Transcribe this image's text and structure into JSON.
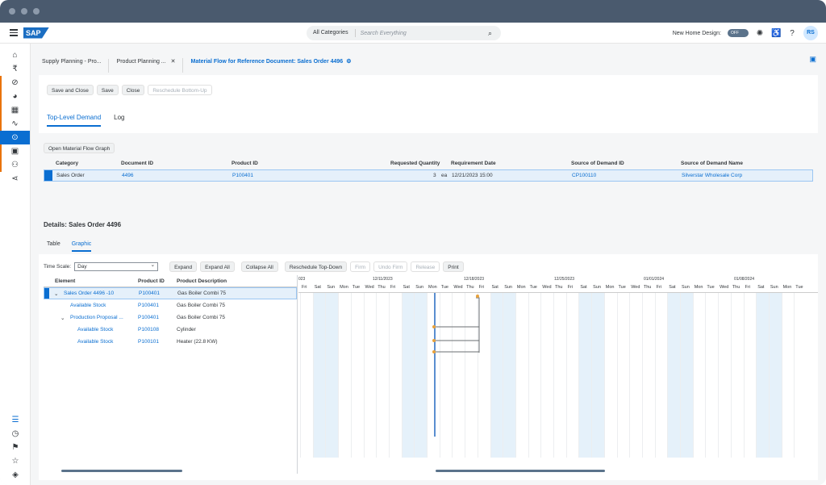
{
  "shell": {
    "brand": "SAP",
    "category": "All Categories",
    "search_placeholder": "Search Everything",
    "new_home_label": "New Home Design:",
    "toggle_label": "OFF",
    "avatar": "RS"
  },
  "tabs": [
    {
      "label": "Supply Planning - Pro..."
    },
    {
      "label": "Product Planning ..."
    },
    {
      "label": "Material Flow for Reference Document: Sales Order 4496"
    }
  ],
  "toolbar": {
    "save_close": "Save and Close",
    "save": "Save",
    "close": "Close",
    "reschedule_bu": "Reschedule Bottom-Up"
  },
  "subtabs": {
    "top_level": "Top-Level Demand",
    "log": "Log"
  },
  "omf_button": "Open Material Flow Graph",
  "demand_table": {
    "headers": {
      "category": "Category",
      "doc_id": "Document ID",
      "product_id": "Product ID",
      "req_qty": "Requested Quantity",
      "req_date": "Requirement Date",
      "src_id": "Source of Demand ID",
      "src_name": "Source of Demand Name"
    },
    "row": {
      "category": "Sales Order",
      "doc_id": "4496",
      "product_id": "P100401",
      "qty": "3",
      "unit": "ea",
      "date": "12/21/2023 15:00",
      "src_id": "CP100110",
      "src_name": "Silverstar Wholesale Corp"
    }
  },
  "details_title": "Details: Sales Order 4496",
  "graph_tabs": {
    "table": "Table",
    "graphic": "Graphic"
  },
  "graph_tools": {
    "time_scale_label": "Time Scale:",
    "time_scale_value": "Day",
    "expand": "Expand",
    "expand_all": "Expand All",
    "collapse_all": "Collapse All",
    "reschedule_td": "Reschedule Top-Down",
    "firm": "Firm",
    "undo_firm": "Undo Firm",
    "release": "Release",
    "print": "Print"
  },
  "tree": {
    "headers": {
      "element": "Element",
      "product_id": "Product ID",
      "description": "Product Description"
    },
    "rows": [
      {
        "element": "Sales Order 4496 -10",
        "product_id": "P100401",
        "description": "Gas Boiler Combi 75"
      },
      {
        "element": "Available Stock",
        "product_id": "P100401",
        "description": "Gas Boiler Combi 75"
      },
      {
        "element": "Production Proposal ...",
        "product_id": "P100401",
        "description": "Gas Boiler Combi 75"
      },
      {
        "element": "Available Stock",
        "product_id": "P100108",
        "description": "Cylinder"
      },
      {
        "element": "Available Stock",
        "product_id": "P100101",
        "description": "Heater (22.8 KW)"
      }
    ]
  },
  "gantt": {
    "weeks": [
      "023",
      "12/11/2023",
      "12/18/2023",
      "12/25/2023",
      "01/01/2024",
      "01/08/2024"
    ],
    "days": [
      "Fri",
      "Sat",
      "Sun",
      "Mon",
      "Tue",
      "Wed",
      "Thu",
      "Fri",
      "Sat",
      "Sun",
      "Mon",
      "Tue",
      "Wed",
      "Thu",
      "Fri",
      "Sat",
      "Sun",
      "Mon",
      "Tue",
      "Wed",
      "Thu",
      "Fri",
      "Sat",
      "Sun",
      "Mon",
      "Tue",
      "Wed",
      "Thu",
      "Fri",
      "Sat",
      "Sun",
      "Mon",
      "Tue",
      "Wed",
      "Thu",
      "Fri",
      "Sat",
      "Sun",
      "Mon",
      "Tue"
    ]
  }
}
